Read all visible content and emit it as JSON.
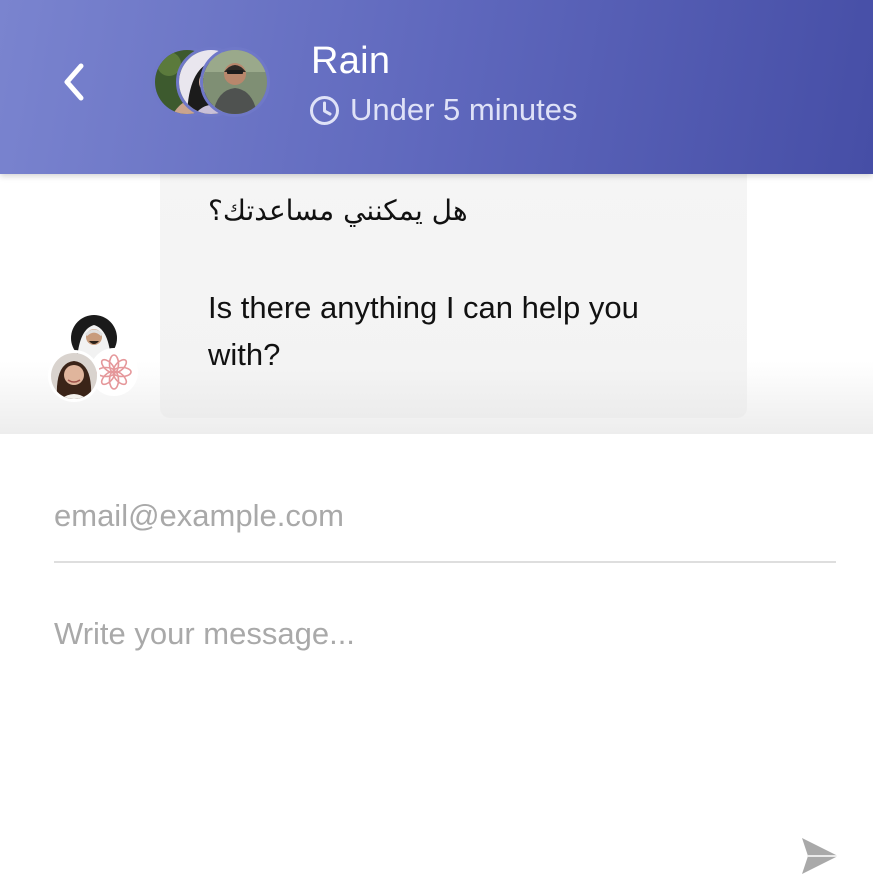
{
  "header": {
    "agent_name": "Rain",
    "response_time": "Under 5 minutes",
    "back_icon": "chevron-left-icon",
    "clock_icon": "clock-icon",
    "team_avatars": [
      "avatar-woman-outdoors",
      "avatar-woman-glasses",
      "avatar-man-bearded"
    ],
    "gradient_colors": [
      "#7a84cf",
      "#464ea6"
    ]
  },
  "conversation": {
    "message": {
      "arabic_text": "هل يمكنني مساعدتك؟",
      "english_text": "Is there anything I can help you with?"
    },
    "sender_avatars": [
      "avatar-man-ghutra",
      "avatar-woman-smiling",
      "flower-logo"
    ]
  },
  "composer": {
    "email_placeholder": "email@example.com",
    "email_value": "",
    "message_placeholder": "Write your message...",
    "message_value": "",
    "send_icon": "send-icon"
  }
}
